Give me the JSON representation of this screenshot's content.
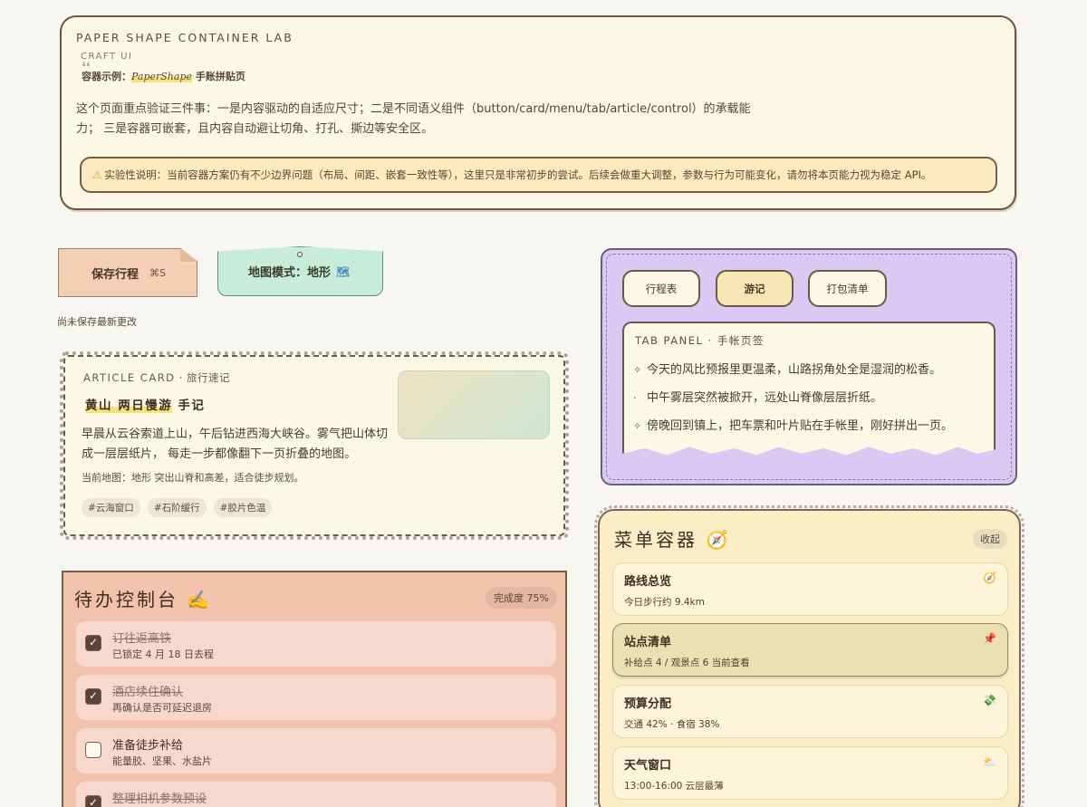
{
  "hero": {
    "title": "PAPER SHAPE CONTAINER LAB",
    "subtitle": "CRAFT UI",
    "quote_mark": "❛❛",
    "example_prefix": "容器示例：",
    "example_highlight": "PaperShape",
    "example_suffix": " 手账拼贴页",
    "description": "这个页面重点验证三件事：一是内容驱动的自适应尺寸；二是不同语义组件（button/card/menu/tab/article/control）的承载能力； 三是容器可嵌套，且内容自动避让切角、打孔、撕边等安全区。",
    "warning_icon": "⚠",
    "warning": "实验性说明：当前容器方案仍有不少边界问题（布局、间距、嵌套一致性等），这里只是非常初步的尝试。后续会做重大调整，参数与行为可能变化，请勿将本页能力视为稳定 API。"
  },
  "buttons": {
    "save_label": "保存行程",
    "save_shortcut": "⌘S",
    "map_label": "地图模式：地形",
    "map_icon": "🗺",
    "unsaved_text": "尚未保存最新更改"
  },
  "article": {
    "kicker": "ARTICLE CARD",
    "kicker_sub": " · 旅行速记",
    "title_highlight": "黄山 两日慢游",
    "title_suffix": " 手记",
    "body": "早晨从云谷索道上山，午后钻进西海大峡谷。雾气把山体切成一层层纸片， 每走一步都像翻下一页折叠的地图。",
    "map_note": "当前地图：地形 突出山脊和高差，适合徒步规划。",
    "tags": [
      "#云海窗口",
      "#石阶缓行",
      "#胶片色温"
    ]
  },
  "tabs": {
    "items": [
      {
        "label": "行程表",
        "active": false
      },
      {
        "label": "游记",
        "active": true
      },
      {
        "label": "打包清单",
        "active": false
      }
    ],
    "panel_head": "TAB PANEL · 手帐页签",
    "panel_lines": [
      {
        "bullet": "✧",
        "text": "今天的风比预报里更温柔，山路拐角处全是湿润的松香。"
      },
      {
        "bullet": "·",
        "text": "中午雾层突然被掀开，远处山脊像层层折纸。"
      },
      {
        "bullet": "✧",
        "text": "傍晚回到镇上，把车票和叶片贴在手帐里，刚好拼出一页。"
      }
    ]
  },
  "todo": {
    "title": "待办控制台 ✍",
    "progress_label": "完成度 75%",
    "progress": 0.75,
    "items": [
      {
        "title": "订往返高铁",
        "sub": "已锁定 4 月 18 日去程",
        "done": true
      },
      {
        "title": "酒店续住确认",
        "sub": "再确认是否可延迟退房",
        "done": true
      },
      {
        "title": "准备徒步补给",
        "sub": "能量胶、坚果、水盐片",
        "done": false
      },
      {
        "title": "整理相机参数预设",
        "sub": "",
        "done": true
      }
    ]
  },
  "menu": {
    "title": "菜单容器 🧭",
    "collapse_label": "收起",
    "items": [
      {
        "title": "路线总览",
        "sub": "今日步行约 9.4km",
        "icon": "🧭",
        "icon_name": "compass-icon"
      },
      {
        "title": "站点清单",
        "sub": "补给点 4 / 观景点 6    当前查看",
        "icon": "📌",
        "icon_name": "pin-icon",
        "active": true
      },
      {
        "title": "预算分配",
        "sub": "交通 42% · 食宿 38%",
        "icon": "💸",
        "icon_name": "money-icon"
      },
      {
        "title": "天气窗口",
        "sub": "13:00-16:00 云层最薄",
        "icon": "⛅",
        "icon_name": "weather-icon"
      }
    ]
  }
}
